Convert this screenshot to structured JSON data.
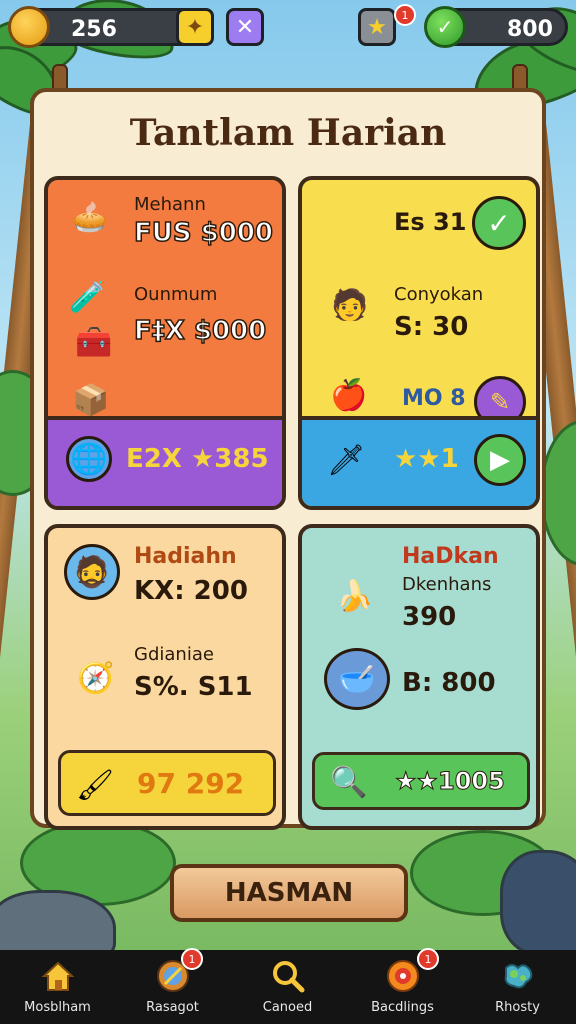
{
  "topbar": {
    "coins": "256",
    "gems": "800",
    "notification_count": "1"
  },
  "board": {
    "title": "Tantlam Harian"
  },
  "cards": [
    {
      "row1_label": "Mehann",
      "row1_amount": "FUS $000",
      "row2_label": "Ounmum",
      "row2_amount": "F‡X $000",
      "footer": "E2X ★385"
    },
    {
      "row1_amount": "Es 31",
      "row2_label": "Conyokan",
      "row2_amount": "S: 30",
      "row3_amount": "MO 8",
      "footer": "★★1"
    },
    {
      "row1_label": "Hadiahn",
      "row1_amount": "KX: 200",
      "row2_label": "Gdianiae",
      "row2_amount": "S%. S11",
      "footer": "97 292"
    },
    {
      "row1_label": "HaDkan",
      "row1_sub": "Dkenhans",
      "row1_amount": "390",
      "row2_amount": "B: 800",
      "footer": "★★1005"
    }
  ],
  "main_button": "HASMAN",
  "nav": [
    {
      "label": "Mosblham",
      "icon": "home-icon"
    },
    {
      "label": "Rasagot",
      "icon": "compass-icon"
    },
    {
      "label": "Canoed",
      "icon": "search-icon"
    },
    {
      "label": "Bacdlings",
      "icon": "target-icon"
    },
    {
      "label": "Rhosty",
      "icon": "map-icon"
    }
  ],
  "nav_badges": [
    "1",
    "1"
  ],
  "colors": {
    "card_orange": "#f37b3f",
    "card_yellow": "#f8dd4e",
    "card_peach": "#fbd8a0",
    "card_mint": "#a7dcd1",
    "footer_purple": "#9a5ad6",
    "footer_blue": "#3aa6e2",
    "footer_yellow": "#f6d53c",
    "footer_green": "#59c45a"
  }
}
